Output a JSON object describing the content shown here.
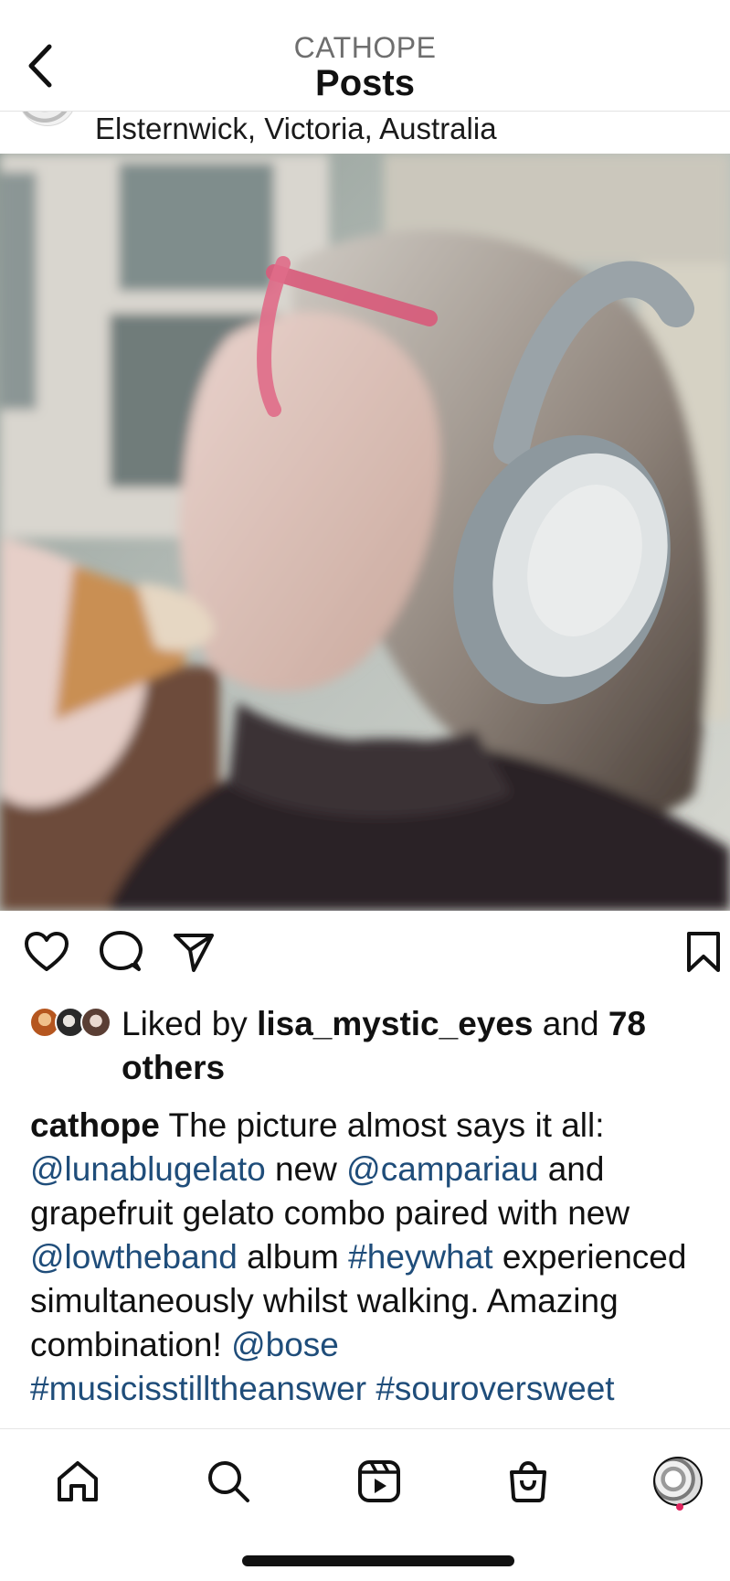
{
  "header": {
    "username": "CATHOPE",
    "title": "Posts"
  },
  "post": {
    "location": "Elsternwick, Victoria, Australia",
    "likes": {
      "prefix": "Liked by ",
      "user": "lisa_mystic_eyes",
      "connector": " and ",
      "others": "78 others"
    },
    "caption": {
      "author": "cathope",
      "t1": " The picture almost says it all: ",
      "m1": "@lunablugelato",
      "t2": " new ",
      "m2": "@campariau",
      "t3": " and grapefruit gelato combo paired with new ",
      "m3": "@lowtheband",
      "t4": " album ",
      "h1": "#heywhat",
      "t5": " experienced simultaneously whilst walking. Amazing combination! ",
      "m4": "@bose",
      "h2": "#musicisstilltheanswer",
      "h3": "#souroversweet"
    }
  },
  "colors": {
    "link": "#1f4d7a",
    "notification_dot": "#e0245e"
  },
  "icons": [
    "back-icon",
    "heart-icon",
    "comment-icon",
    "share-icon",
    "bookmark-icon",
    "home-icon",
    "search-icon",
    "reels-icon",
    "shop-icon"
  ]
}
